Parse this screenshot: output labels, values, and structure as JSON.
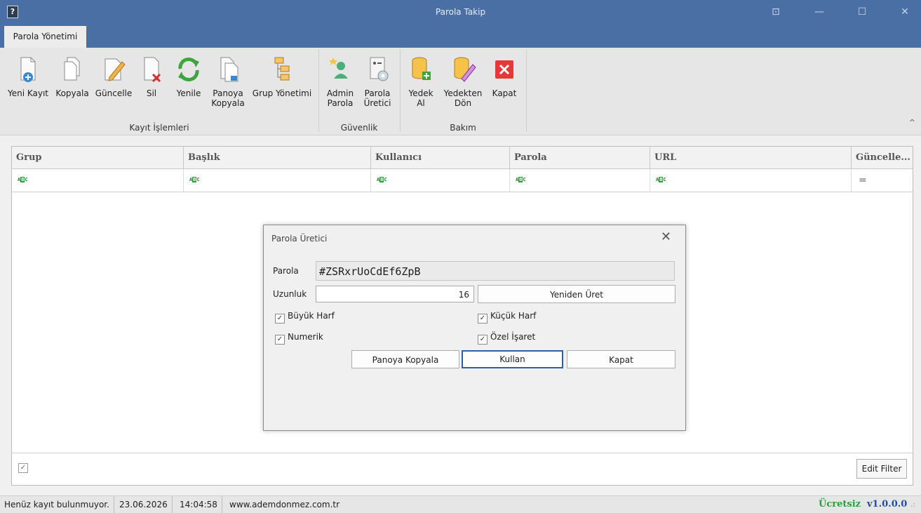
{
  "window": {
    "title": "Parola Takip",
    "icon_symbol": "?",
    "buttons": {
      "pin": "⊡",
      "minimize": "—",
      "maximize": "☐",
      "close": "✕"
    }
  },
  "tabs": [
    {
      "label": "Parola Yönetimi",
      "active": true
    }
  ],
  "ribbon": {
    "groups": [
      {
        "label": "Kayıt İşlemleri"
      },
      {
        "label": "Güvenlik"
      },
      {
        "label": "Bakım"
      }
    ],
    "buttons": [
      {
        "label": "Yeni Kayıt",
        "icon": "new-document-icon"
      },
      {
        "label": "Kopyala",
        "icon": "copy-document-icon"
      },
      {
        "label": "Güncelle",
        "icon": "edit-document-icon"
      },
      {
        "label": "Sil",
        "icon": "delete-document-icon"
      },
      {
        "label": "Yenile",
        "icon": "refresh-icon"
      },
      {
        "label": "Panoya Kopyala",
        "icon": "clipboard-copy-icon"
      },
      {
        "label": "Grup Yönetimi",
        "icon": "group-tree-icon"
      },
      {
        "label": "Admin Parola",
        "icon": "admin-user-icon"
      },
      {
        "label": "Parola Üretici",
        "icon": "password-generator-icon"
      },
      {
        "label": "Yedek Al",
        "icon": "backup-database-icon"
      },
      {
        "label": "Yedekten Dön",
        "icon": "restore-database-icon"
      },
      {
        "label": "Kapat",
        "icon": "close-red-icon"
      }
    ],
    "collapse_symbol": "^"
  },
  "grid": {
    "columns": [
      "Grup",
      "Başlık",
      "Kullanıcı",
      "Parola",
      "URL",
      "Güncelle..."
    ],
    "filter_glyph": "ABC",
    "filter_eq_glyph": "=",
    "footer": {
      "checkbox_mark": "✓",
      "edit_filter": "Edit Filter"
    }
  },
  "dialog": {
    "title": "Parola Üretici",
    "close_symbol": "✕",
    "password_label": "Parola",
    "password_value": "#ZSRxrUoCdEf6ZpB",
    "length_label": "Uzunluk",
    "length_value": "16",
    "regenerate_label": "Yeniden Üret",
    "checkboxes": [
      {
        "label": "Büyük Harf",
        "checked": true
      },
      {
        "label": "Küçük Harf",
        "checked": true
      },
      {
        "label": "Numerik",
        "checked": true
      },
      {
        "label": "Özel İşaret",
        "checked": true
      }
    ],
    "check_mark": "✓",
    "copy_label": "Panoya Kopyala",
    "use_label": "Kullan",
    "close_label": "Kapat"
  },
  "statusbar": {
    "message": "Henüz kayıt bulunmuyor.",
    "date": "23.06.2026",
    "time": "14:04:58",
    "website": "www.ademdonmez.com.tr",
    "license": "Ücretsiz",
    "version": "v1.0.0.0",
    "grip": ".:"
  },
  "colors": {
    "title_bar": "#4a6fa5",
    "license_green": "#2e9d3a",
    "version_blue": "#1f4fa0",
    "primary_button_border": "#2e5ea3"
  }
}
